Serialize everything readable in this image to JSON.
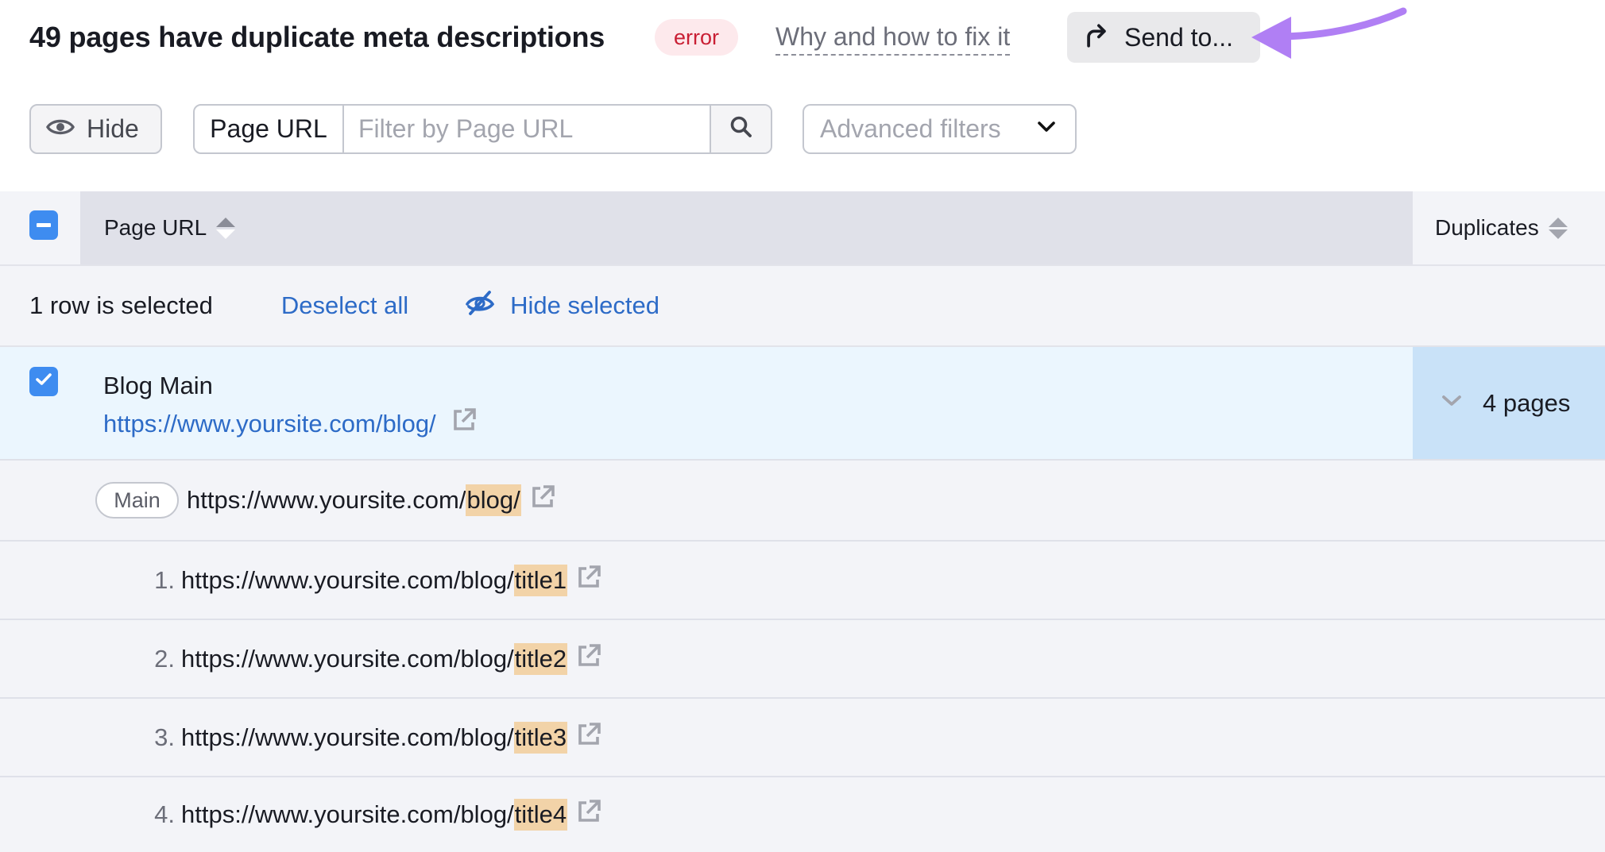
{
  "header": {
    "title": "49 pages have duplicate meta descriptions",
    "badge": "error",
    "why_link": "Why and how to fix it",
    "send_to_label": "Send to..."
  },
  "filters": {
    "hide_label": "Hide",
    "search_field_label": "Page URL",
    "search_placeholder": "Filter by Page URL",
    "search_value": "",
    "advanced_label": "Advanced filters"
  },
  "table": {
    "columns": {
      "page_url": "Page URL",
      "duplicates": "Duplicates"
    },
    "selection": {
      "count_text": "1 row is selected",
      "deselect_all": "Deselect all",
      "hide_selected": "Hide selected"
    },
    "rows": [
      {
        "title": "Blog Main",
        "url": "https://www.yoursite.com/blog/",
        "selected": true,
        "duplicates": "4 pages",
        "expanded": {
          "main": {
            "pill": "Main",
            "url_prefix": "https://www.yoursite.com/",
            "url_highlight": "blog/"
          },
          "items": [
            {
              "num": "1.",
              "url_prefix": "https://www.yoursite.com/blog/",
              "url_highlight": "title1"
            },
            {
              "num": "2.",
              "url_prefix": "https://www.yoursite.com/blog/",
              "url_highlight": "title2"
            },
            {
              "num": "3.",
              "url_prefix": "https://www.yoursite.com/blog/",
              "url_highlight": "title3"
            },
            {
              "num": "4.",
              "url_prefix": "https://www.yoursite.com/blog/",
              "url_highlight": "title4"
            }
          ]
        }
      }
    ]
  },
  "colors": {
    "accent_blue": "#3e8cf0",
    "link_blue": "#2d6bc7",
    "error_red": "#c91f34",
    "highlight": "#f2d3a8",
    "annotation_purple": "#b07ff4"
  },
  "icons": {
    "send": "share-arrow-icon",
    "hide": "eye-icon",
    "search": "search-icon",
    "advanced": "chevron-down-icon",
    "hide_selected": "eye-slash-icon",
    "external": "external-link-icon"
  }
}
